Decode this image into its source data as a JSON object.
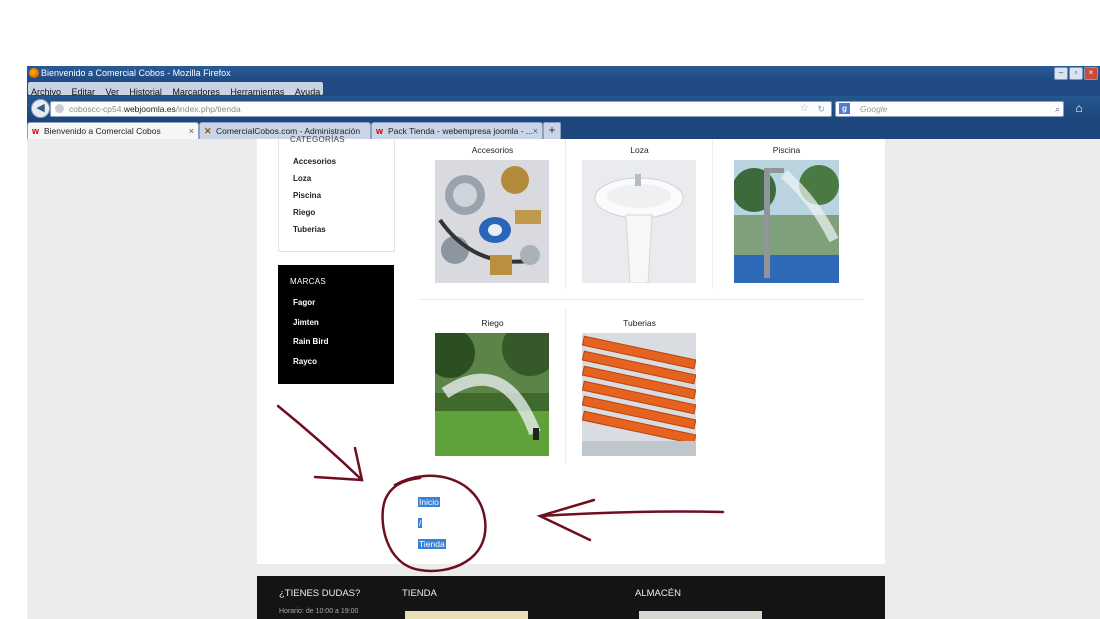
{
  "window": {
    "title": "Bienvenido a Comercial Cobos - Mozilla Firefox",
    "controls": [
      "–",
      "▫",
      "×"
    ]
  },
  "menu": [
    "Archivo",
    "Editar",
    "Ver",
    "Historial",
    "Marcadores",
    "Herramientas",
    "Ayuda"
  ],
  "address": {
    "prefix": "coboscc-cp54.",
    "domain": "webjoomla.es",
    "path": "/index.php/tienda"
  },
  "search": {
    "placeholder": "Google",
    "engine_letter": "g"
  },
  "tabs": [
    {
      "label": "Bienvenido a Comercial Cobos",
      "active": true
    },
    {
      "label": "ComercialCobos.com - Administración",
      "active": false
    },
    {
      "label": "Pack Tienda - webempresa joomla - ...",
      "active": false
    }
  ],
  "newtab": "+",
  "sidebar": {
    "categories_title": "CATEGORÍAS",
    "categories": [
      "Accesorios",
      "Loza",
      "Piscina",
      "Riego",
      "Tuberias"
    ],
    "brands_title": "MARCAS",
    "brands": [
      "Fagor",
      "Jimten",
      "Rain Bird",
      "Rayco"
    ]
  },
  "products": [
    {
      "name": "Accesorios",
      "image": "plumbing-fittings"
    },
    {
      "name": "Loza",
      "image": "pedestal-sink"
    },
    {
      "name": "Piscina",
      "image": "pool-shower"
    },
    {
      "name": "Riego",
      "image": "lawn-sprinkler"
    },
    {
      "name": "Tuberias",
      "image": "orange-pipes"
    }
  ],
  "breadcrumb": {
    "home": "Inicio",
    "separator": "/",
    "current": "Tienda"
  },
  "footer": {
    "col1_title": "¿TIENES DUDAS?",
    "col1_text": "Horario: de 10:00 a 19:00",
    "col2_title": "TIENDA",
    "col3_title": "ALMACÉN"
  },
  "colors": {
    "annotation": "#6e0f1f",
    "selection": "#3a7fd8",
    "titlebar": "#1f4a83"
  }
}
